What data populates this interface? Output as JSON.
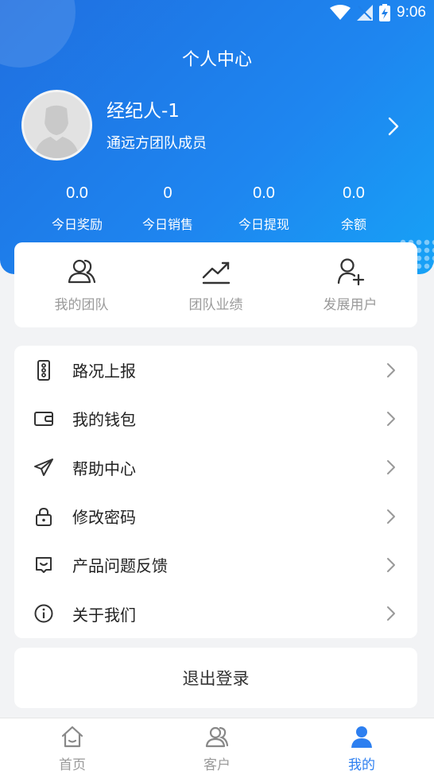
{
  "status_bar": {
    "time": "9:06"
  },
  "header": {
    "title": "个人中心"
  },
  "profile": {
    "name": "经纪人-1",
    "role": "通远方团队成员"
  },
  "stats": [
    {
      "value": "0.0",
      "label": "今日奖励"
    },
    {
      "value": "0",
      "label": "今日销售"
    },
    {
      "value": "0.0",
      "label": "今日提现"
    },
    {
      "value": "0.0",
      "label": "余额"
    }
  ],
  "quick_actions": [
    {
      "label": "我的团队",
      "icon": "team-icon"
    },
    {
      "label": "团队业绩",
      "icon": "trend-chart-icon"
    },
    {
      "label": "发展用户",
      "icon": "add-user-icon"
    }
  ],
  "menu": [
    {
      "label": "路况上报",
      "icon": "traffic-light-icon"
    },
    {
      "label": "我的钱包",
      "icon": "wallet-icon"
    },
    {
      "label": "帮助中心",
      "icon": "paper-plane-icon"
    },
    {
      "label": "修改密码",
      "icon": "lock-icon"
    },
    {
      "label": "产品问题反馈",
      "icon": "feedback-icon"
    },
    {
      "label": "关于我们",
      "icon": "info-icon"
    }
  ],
  "logout_label": "退出登录",
  "tabs": [
    {
      "label": "首页",
      "icon": "home-icon"
    },
    {
      "label": "客户",
      "icon": "customers-icon"
    },
    {
      "label": "我的",
      "icon": "profile-icon",
      "active": true
    }
  ],
  "colors": {
    "header_start": "#1f6fe0",
    "header_end": "#17a2f6",
    "accent": "#2d7ff0"
  }
}
